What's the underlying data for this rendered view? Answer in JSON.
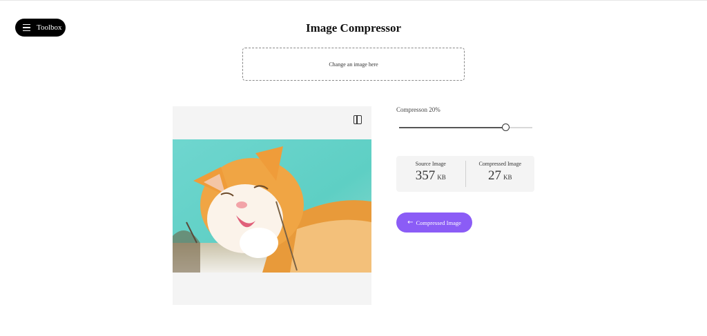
{
  "toolbox": {
    "label": "Toolbox",
    "icon": "menu-icon"
  },
  "page": {
    "title": "Image Compressor"
  },
  "dropzone": {
    "text": "Change an image here"
  },
  "preview": {
    "compare_icon": "split-view-icon"
  },
  "compression": {
    "label": "Compresson",
    "value_text": "20%",
    "slider_fraction": 0.8
  },
  "sizes": {
    "source": {
      "caption": "Source Image",
      "value": "357",
      "unit": "KB"
    },
    "compressed": {
      "caption": "Compressed Image",
      "value": "27",
      "unit": "KB"
    }
  },
  "action": {
    "label": "Compressed Image",
    "icon": "arrow-left-icon",
    "color": "#8b5cf6"
  }
}
